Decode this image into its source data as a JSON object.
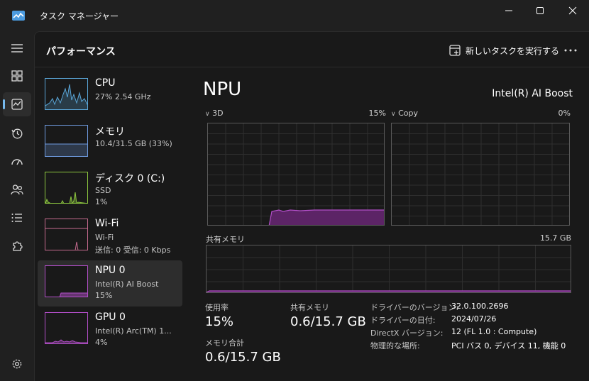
{
  "window": {
    "title": "タスク マネージャー"
  },
  "colors": {
    "cpu": "#5aa6d8",
    "memory": "#6f9be0",
    "disk": "#8cc63f",
    "wifi": "#c56a8e",
    "npu": "#b34fc9",
    "gpu": "#b34fc9"
  },
  "nav": {
    "items": [
      {
        "name": "menu",
        "icon": "hamburger-icon"
      },
      {
        "name": "processes",
        "icon": "processes-icon"
      },
      {
        "name": "performance",
        "icon": "performance-icon",
        "active": true
      },
      {
        "name": "app-history",
        "icon": "history-icon"
      },
      {
        "name": "startup-apps",
        "icon": "speedometer-icon"
      },
      {
        "name": "users",
        "icon": "users-icon"
      },
      {
        "name": "details",
        "icon": "list-icon"
      },
      {
        "name": "services",
        "icon": "puzzle-icon"
      },
      {
        "name": "settings",
        "icon": "gear-icon"
      }
    ]
  },
  "header": {
    "title": "パフォーマンス",
    "run_task_label": "新しいタスクを実行する",
    "more_icon": "more-icon"
  },
  "devices": [
    {
      "name": "CPU",
      "sub1": "27%  2.54 GHz",
      "sub2": "",
      "color": "#5aa6d8"
    },
    {
      "name": "メモリ",
      "sub1": "10.4/31.5 GB (33%)",
      "sub2": "",
      "color": "#6f9be0"
    },
    {
      "name": "ディスク 0 (C:)",
      "sub1": "SSD",
      "sub2": "1%",
      "color": "#8cc63f"
    },
    {
      "name": "Wi-Fi",
      "sub1": "Wi-Fi",
      "sub2": "送信: 0 受信: 0 Kbps",
      "color": "#c56a8e"
    },
    {
      "name": "NPU 0",
      "sub1": "Intel(R) AI Boost",
      "sub2": "15%",
      "color": "#b34fc9",
      "selected": true
    },
    {
      "name": "GPU 0",
      "sub1": "Intel(R) Arc(TM) 1...",
      "sub2": "4%",
      "color": "#b34fc9"
    }
  ],
  "detail": {
    "title": "NPU",
    "model": "Intel(R) AI Boost",
    "graph_3d": {
      "label": "3D",
      "max_label": "15%"
    },
    "graph_copy": {
      "label": "Copy",
      "max_label": "0%"
    },
    "graph_shared": {
      "label": "共有メモリ",
      "max_label": "15.7 GB"
    },
    "stats": {
      "utilization_label": "使用率",
      "utilization_value": "15%",
      "shared_mem_label": "共有メモリ",
      "shared_mem_value": "0.6/15.7 GB",
      "mem_total_label": "メモリ合計",
      "mem_total_value": "0.6/15.7 GB"
    },
    "info": [
      {
        "key": "ドライバーのバージョン:",
        "value": "32.0.100.2696"
      },
      {
        "key": "ドライバーの日付:",
        "value": "2024/07/26"
      },
      {
        "key": "DirectX バージョン:",
        "value": "12 (FL 1.0 : Compute)"
      },
      {
        "key": "物理的な場所:",
        "value": "PCI バス 0, デバイス 11, 機能 0"
      }
    ]
  }
}
